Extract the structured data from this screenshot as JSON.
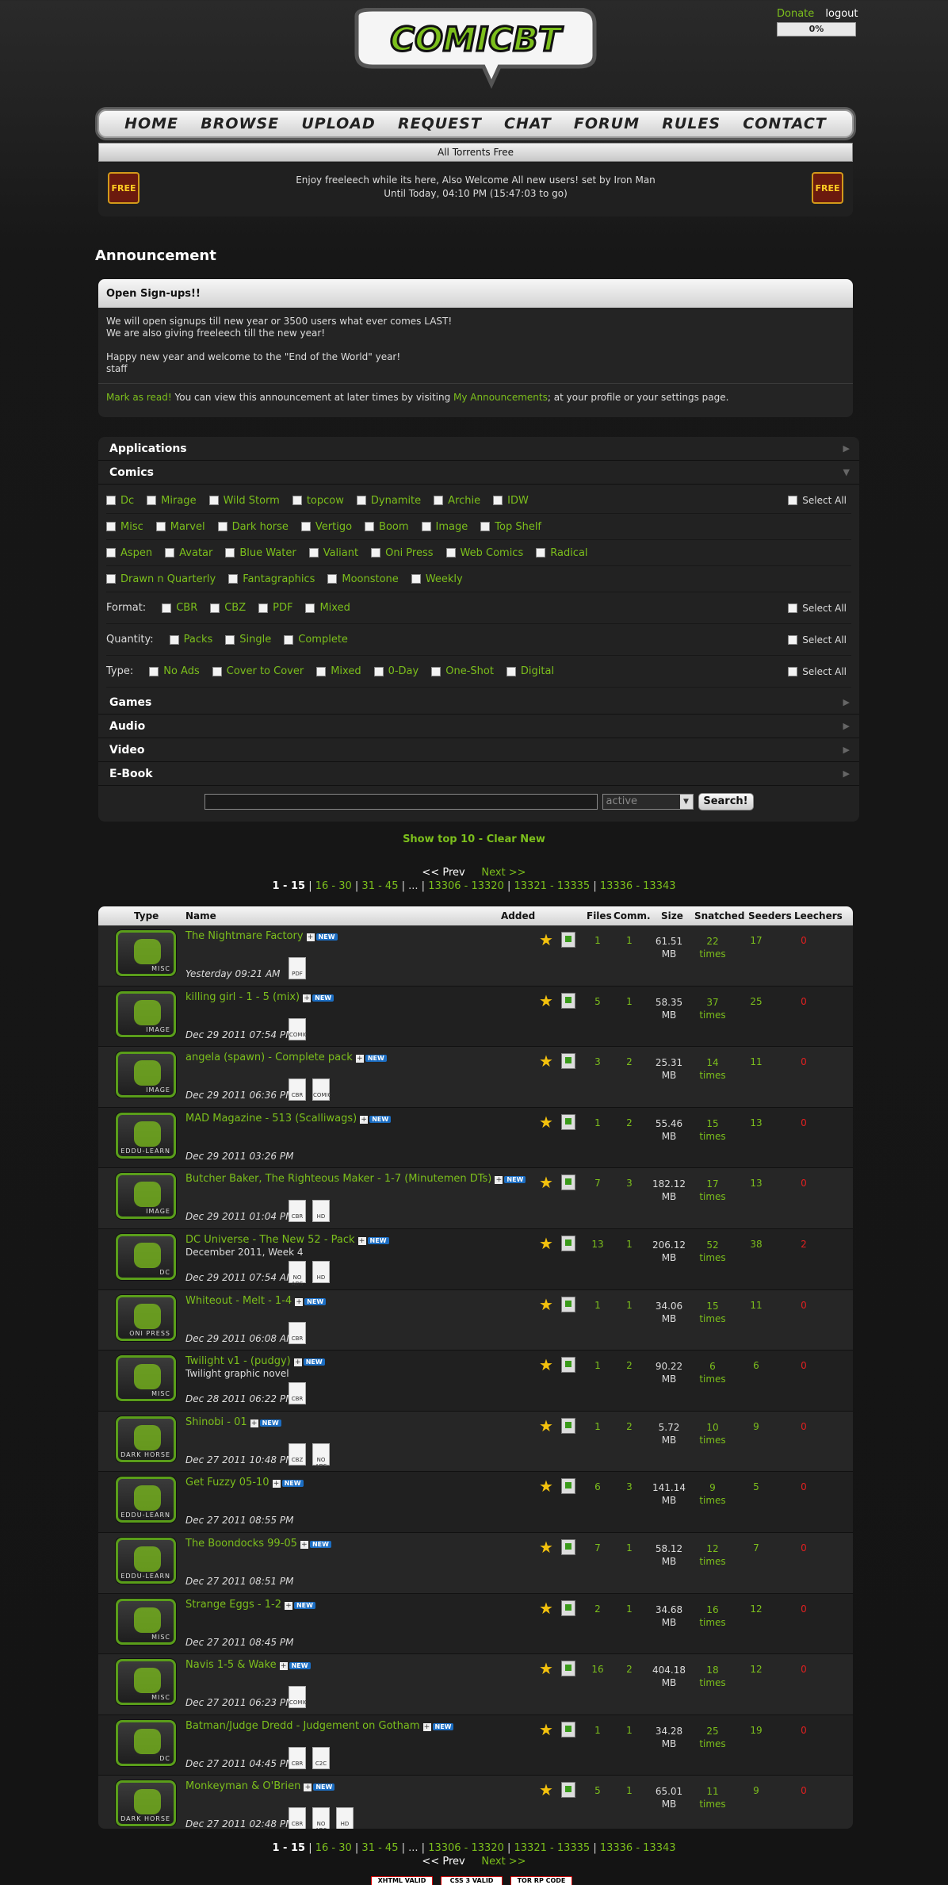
{
  "header": {
    "logo_text": "COMICBT",
    "donate": "Donate",
    "logout": "logout",
    "progress": "0%"
  },
  "nav": [
    "HOME",
    "BROWSE",
    "UPLOAD",
    "REQUEST",
    "CHAT",
    "FORUM",
    "RULES",
    "CONTACT"
  ],
  "freeleech": {
    "bar": "All Torrents Free",
    "line1": "Enjoy freeleech while its here, Also Welcome All new users! set by Iron Man",
    "line2": "Until Today, 04:10 PM (15:47:03 to go)",
    "icon": "FREE"
  },
  "announcement": {
    "title": "Announcement",
    "head": "Open Sign-ups!!",
    "lines": [
      "We will open signups till new year or 3500 users what ever comes LAST!",
      "We are also giving freeleech till the new year!",
      "",
      "Happy new year and welcome to the \"End of the World\" year!",
      "staff"
    ],
    "mark": "Mark as read!",
    "foot1": " You can view this announcement at later times by visiting ",
    "myann": "My Announcements",
    "foot2": "; at your profile or your settings page."
  },
  "categories": {
    "applications": "Applications",
    "comics": "Comics",
    "publishers": [
      [
        "Dc",
        "Mirage",
        "Wild Storm",
        "topcow",
        "Dynamite",
        "Archie",
        "IDW"
      ],
      [
        "Misc",
        "Marvel",
        "Dark horse",
        "Vertigo",
        "Boom",
        "Image",
        "Top Shelf"
      ],
      [
        "Aspen",
        "Avatar",
        "Blue Water",
        "Valiant",
        "Oni Press",
        "Web Comics",
        "Radical"
      ],
      [
        "Drawn n Quarterly",
        "Fantagraphics",
        "Moonstone",
        "Weekly"
      ]
    ],
    "select_all": "Select All",
    "format_label": "Format:",
    "format": [
      "CBR",
      "CBZ",
      "PDF",
      "Mixed"
    ],
    "quantity_label": "Quantity:",
    "quantity": [
      "Packs",
      "Single",
      "Complete"
    ],
    "type_label": "Type:",
    "type": [
      "No Ads",
      "Cover to Cover",
      "Mixed",
      "0-Day",
      "One-Shot",
      "Digital"
    ],
    "games": "Games",
    "audio": "Audio",
    "video": "Video",
    "ebook": "E-Book"
  },
  "search": {
    "value": "",
    "select": "active",
    "button": "Search!"
  },
  "showtop": "Show top 10",
  "clearnew": "Clear New",
  "pager": {
    "prev": "<< Prev",
    "next": "Next >>",
    "current": "1 - 15",
    "pages": [
      "16 - 30",
      "31 - 45",
      "...",
      "13306 - 13320",
      "13321 - 13335",
      "13336 - 13343"
    ]
  },
  "table": {
    "headers": {
      "type": "Type",
      "name": "Name",
      "added": "Added",
      "files": "Files",
      "comm": "Comm.",
      "size": "Size",
      "snatched": "Snatched",
      "seeders": "Seeders",
      "leechers": "Leechers"
    },
    "times": "times",
    "rows": [
      {
        "type": "MISC",
        "name": "The Nightmare Factory",
        "sub": "",
        "date": "Yesterday 09:21 AM",
        "files": "1",
        "comm": "1",
        "size": "61.51",
        "unit": "MB",
        "snatched": "22",
        "seeders": "17",
        "leechers": "0",
        "icons": [
          "pdf"
        ]
      },
      {
        "type": "IMAGE",
        "name": "killing girl - 1 - 5 (mix)",
        "sub": "",
        "date": "Dec 29 2011 07:54 PM",
        "files": "5",
        "comm": "1",
        "size": "58.35",
        "unit": "MB",
        "snatched": "37",
        "seeders": "25",
        "leechers": "0",
        "icons": [
          "comic"
        ]
      },
      {
        "type": "IMAGE",
        "name": "angela (spawn) - Complete pack",
        "sub": "",
        "date": "Dec 29 2011 06:36 PM",
        "files": "3",
        "comm": "2",
        "size": "25.31",
        "unit": "MB",
        "snatched": "14",
        "seeders": "11",
        "leechers": "0",
        "icons": [
          "cbr",
          "comic"
        ]
      },
      {
        "type": "EDDU-LEARN",
        "name": "MAD Magazine - 513 (Scalliwags)",
        "sub": "",
        "date": "Dec 29 2011 03:26 PM",
        "files": "1",
        "comm": "2",
        "size": "55.46",
        "unit": "MB",
        "snatched": "15",
        "seeders": "13",
        "leechers": "0",
        "icons": []
      },
      {
        "type": "IMAGE",
        "name": "Butcher Baker, The Righteous Maker - 1-7 (Minutemen DTs)",
        "sub": "",
        "date": "Dec 29 2011 01:04 PM",
        "files": "7",
        "comm": "3",
        "size": "182.12",
        "unit": "MB",
        "snatched": "17",
        "seeders": "13",
        "leechers": "0",
        "icons": [
          "cbr",
          "hd"
        ]
      },
      {
        "type": "DC",
        "name": "DC Universe - The New 52 - Pack",
        "sub": "December 2011, Week 4",
        "date": "Dec 29 2011 07:54 AM",
        "files": "13",
        "comm": "1",
        "size": "206.12",
        "unit": "MB",
        "snatched": "52",
        "seeders": "38",
        "leechers": "2",
        "icons": [
          "noads",
          "hd"
        ]
      },
      {
        "type": "ONI PRESS",
        "name": "Whiteout - Melt - 1-4",
        "sub": "",
        "date": "Dec 29 2011 06:08 AM",
        "files": "1",
        "comm": "1",
        "size": "34.06",
        "unit": "MB",
        "snatched": "15",
        "seeders": "11",
        "leechers": "0",
        "icons": [
          "cbr"
        ]
      },
      {
        "type": "MISC",
        "name": "Twilight v1 - (pudgy)",
        "sub": "Twilight graphic novel",
        "date": "Dec 28 2011 06:22 PM",
        "files": "1",
        "comm": "2",
        "size": "90.22",
        "unit": "MB",
        "snatched": "6",
        "seeders": "6",
        "leechers": "0",
        "icons": [
          "cbr"
        ]
      },
      {
        "type": "DARK HORSE",
        "name": "Shinobi - 01",
        "sub": "",
        "date": "Dec 27 2011 10:48 PM",
        "files": "1",
        "comm": "2",
        "size": "5.72",
        "unit": "MB",
        "snatched": "10",
        "seeders": "9",
        "leechers": "0",
        "icons": [
          "cbz",
          "noads"
        ]
      },
      {
        "type": "EDDU-LEARN",
        "name": "Get Fuzzy 05-10",
        "sub": "",
        "date": "Dec 27 2011 08:55 PM",
        "files": "6",
        "comm": "3",
        "size": "141.14",
        "unit": "MB",
        "snatched": "9",
        "seeders": "5",
        "leechers": "0",
        "icons": []
      },
      {
        "type": "EDDU-LEARN",
        "name": "The Boondocks 99-05",
        "sub": "",
        "date": "Dec 27 2011 08:51 PM",
        "files": "7",
        "comm": "1",
        "size": "58.12",
        "unit": "MB",
        "snatched": "12",
        "seeders": "7",
        "leechers": "0",
        "icons": []
      },
      {
        "type": "MISC",
        "name": "Strange Eggs - 1-2",
        "sub": "",
        "date": "Dec 27 2011 08:45 PM",
        "files": "2",
        "comm": "1",
        "size": "34.68",
        "unit": "MB",
        "snatched": "16",
        "seeders": "12",
        "leechers": "0",
        "icons": []
      },
      {
        "type": "MISC",
        "name": "Navis 1-5 & Wake",
        "sub": "",
        "date": "Dec 27 2011 06:23 PM",
        "files": "16",
        "comm": "2",
        "size": "404.18",
        "unit": "MB",
        "snatched": "18",
        "seeders": "12",
        "leechers": "0",
        "icons": [
          "comic"
        ]
      },
      {
        "type": "DC",
        "name": "Batman/Judge Dredd - Judgement on Gotham",
        "sub": "",
        "date": "Dec 27 2011 04:45 PM",
        "files": "1",
        "comm": "1",
        "size": "34.28",
        "unit": "MB",
        "snatched": "25",
        "seeders": "19",
        "leechers": "0",
        "icons": [
          "cbr",
          "c2c"
        ]
      },
      {
        "type": "DARK HORSE",
        "name": "Monkeyman & O'Brien",
        "sub": "",
        "date": "Dec 27 2011 02:48 PM",
        "files": "5",
        "comm": "1",
        "size": "65.01",
        "unit": "MB",
        "snatched": "11",
        "seeders": "9",
        "leechers": "0",
        "icons": [
          "cbr",
          "noads",
          "hd"
        ]
      }
    ]
  },
  "ratios": [
    "XHTML VALID",
    "CSS 3 VALID",
    "TOR RP CODE"
  ],
  "colors": {
    "accent": "#7cbf1c",
    "leech": "#e02020",
    "new_badge": "#1c6ec3"
  }
}
